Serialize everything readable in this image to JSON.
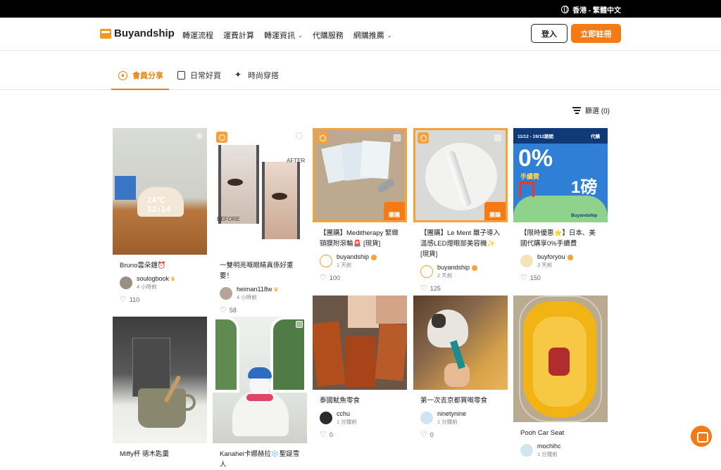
{
  "topbar": {
    "region": "香港 - 繁體中文"
  },
  "header": {
    "logo": "Buyandship",
    "nav": [
      "轉運流程",
      "運費計算",
      "轉運資訊",
      "代購服務",
      "網購推薦"
    ],
    "login": "登入",
    "signup": "立即註冊"
  },
  "tabs": [
    "會員分享",
    "日常好買",
    "時尚穿搭"
  ],
  "filter": {
    "label": "篩選 (0)"
  },
  "cards": [
    {
      "title": "Bruno雲朵鐘⏰",
      "user": "soulogbook",
      "time": "4 小時前",
      "likes": "110"
    },
    {
      "title": "一雙明亮嘅眼睛真係好重要！",
      "user": "heiman118w",
      "time": "4 小時前",
      "likes": "58"
    },
    {
      "title": "【團購】Meditherapy 緊緻頸膜附滾輪🚨 [現貨]",
      "user": "buyandship",
      "time": "1 天前",
      "likes": "100",
      "tag": "團購"
    },
    {
      "title": "【團購】Le Ment 離子導入溫感LED燈眼部美容機✨ [現貨]",
      "user": "buyandship",
      "time": "2 天前",
      "likes": "125",
      "tag": "團購"
    },
    {
      "title": "【限時優惠⭐】日本、美國代購享0%手續費",
      "user": "buyforyou",
      "time": "3 天前",
      "likes": "150"
    },
    {
      "title": "Miffy杯 德木匙羹",
      "user": "",
      "time": "",
      "likes": ""
    },
    {
      "title": "Kanahei卡娜赫拉❄️聖誕雪人",
      "user": "",
      "time": "",
      "likes": ""
    },
    {
      "title": "泰國魷魚零食",
      "user": "cchu",
      "time": "1 分鐘前",
      "likes": "0"
    },
    {
      "title": "第一次去京都買嘅零食",
      "user": "ninetynine",
      "time": "1 分鐘前",
      "likes": "0"
    },
    {
      "title": "Pooh Car Seat",
      "user": "mochihc",
      "time": "1 分鐘前",
      "likes": ""
    }
  ],
  "promo": {
    "dates": "11/12 - 19/12期間",
    "agent": "代購",
    "big": "0%",
    "sub": "手續費",
    "price": "1磅",
    "brand": "Buyandship"
  },
  "colors": {
    "accent": "#f47a15",
    "highlight": "#f4a23c"
  }
}
